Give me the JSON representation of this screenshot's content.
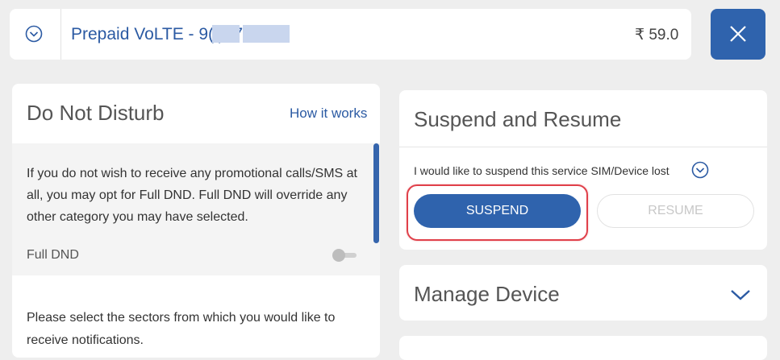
{
  "header": {
    "plan_label": "Prepaid VoLTE - 9(   )97",
    "price": "₹ 59.0",
    "close_icon": "close-icon",
    "expand_icon": "chevron-down-circle-icon"
  },
  "dnd": {
    "title": "Do Not Disturb",
    "how_it_works": "How it works",
    "description": "If you do not wish to receive any promotional calls/SMS at all, you may opt for Full DND. Full DND will override any other category you may have selected.",
    "full_dnd_label": "Full DND",
    "full_dnd_enabled": false,
    "sectors_text": "Please select the sectors from which you would like to receive notifications."
  },
  "suspend_resume": {
    "title": "Suspend and Resume",
    "prompt": "I would like to suspend this service",
    "reason": "SIM/Device lost",
    "suspend_label": "SUSPEND",
    "resume_label": "RESUME"
  },
  "manage_device": {
    "title": "Manage Device"
  },
  "colors": {
    "accent": "#2f63ad",
    "link": "#2b5aa3",
    "highlight": "#e0404a",
    "background": "#eeeeee"
  }
}
